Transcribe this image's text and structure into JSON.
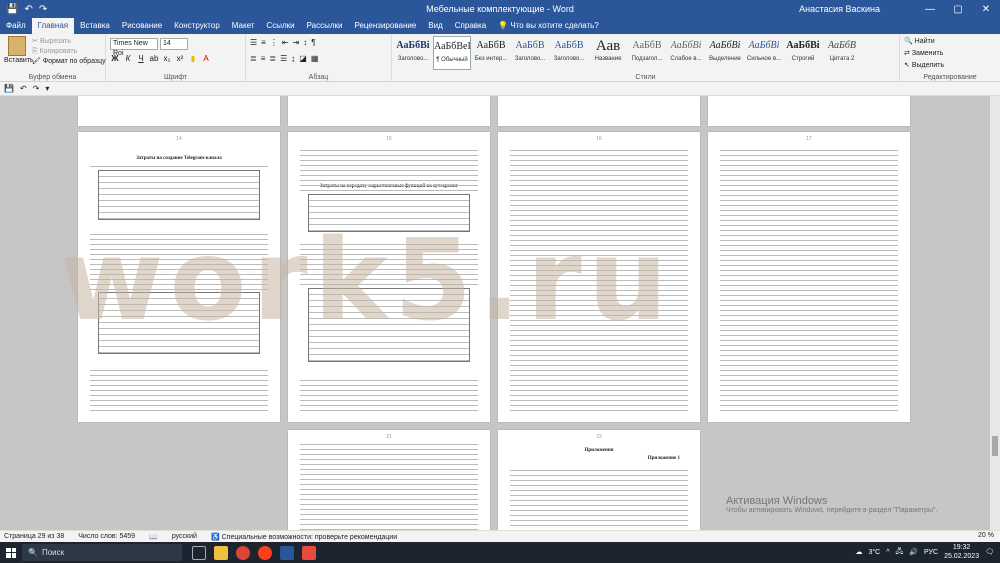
{
  "window": {
    "title": "Мебельные комплектующие  -  Word",
    "user": "Анастасия Васкина"
  },
  "tabs": [
    "Файл",
    "Главная",
    "Вставка",
    "Рисование",
    "Конструктор",
    "Макет",
    "Ссылки",
    "Рассылки",
    "Рецензирование",
    "Вид",
    "Справка"
  ],
  "tell_me": "Что вы хотите сделать?",
  "clipboard": {
    "paste": "Вставить",
    "cut": "Вырезать",
    "copy": "Копировать",
    "format_painter": "Формат по образцу",
    "label": "Буфер обмена"
  },
  "font": {
    "name": "Times New Roi",
    "size": "14",
    "label": "Шрифт"
  },
  "paragraph_label": "Абзац",
  "styles": {
    "label": "Стили",
    "items": [
      {
        "preview": "АаБбВі",
        "name": "Заголово..."
      },
      {
        "preview": "АаБбВеI",
        "name": "¶ Обычный"
      },
      {
        "preview": "АаБбВ",
        "name": "Без интер..."
      },
      {
        "preview": "АаБбВ",
        "name": "Заголово..."
      },
      {
        "preview": "АаБбВ",
        "name": "Заголово..."
      },
      {
        "preview": "Аав",
        "name": "Название"
      },
      {
        "preview": "АаБбВ",
        "name": "Подзагол..."
      },
      {
        "preview": "АаБбВі",
        "name": "Слабое в..."
      },
      {
        "preview": "АаБбВі",
        "name": "Выделение"
      },
      {
        "preview": "АаБбВі",
        "name": "Сильное в..."
      },
      {
        "preview": "АаБбВі",
        "name": "Строгий"
      },
      {
        "preview": "АаБбВ",
        "name": "Цитата 2"
      }
    ]
  },
  "editing": {
    "find": "Найти",
    "replace": "Заменить",
    "select": "Выделить",
    "label": "Редактирование"
  },
  "page_numbers": [
    "14",
    "15",
    "16",
    "17",
    "21",
    "22"
  ],
  "page_headings": {
    "p1": "Затраты на создание Telegram-канала",
    "p2": "Затраты на передачу маркетинговых функций на аутсорсинг",
    "p3": "Приложения",
    "p4": "Приложение 1"
  },
  "watermark": "work5.ru",
  "activation": {
    "title": "Активация Windows",
    "subtitle": "Чтобы активировать Windows, перейдите в раздел \"Параметры\"."
  },
  "status": {
    "page": "Страница 29 из 38",
    "words": "Число слов: 5459",
    "lang": "русский",
    "accessibility": "Специальные возможности: проверьте рекомендации",
    "zoom": "20 %"
  },
  "taskbar": {
    "search": "Поиск",
    "weather": "3°C",
    "lang": "РУС",
    "time": "19:32",
    "date": "25.02.2023"
  }
}
